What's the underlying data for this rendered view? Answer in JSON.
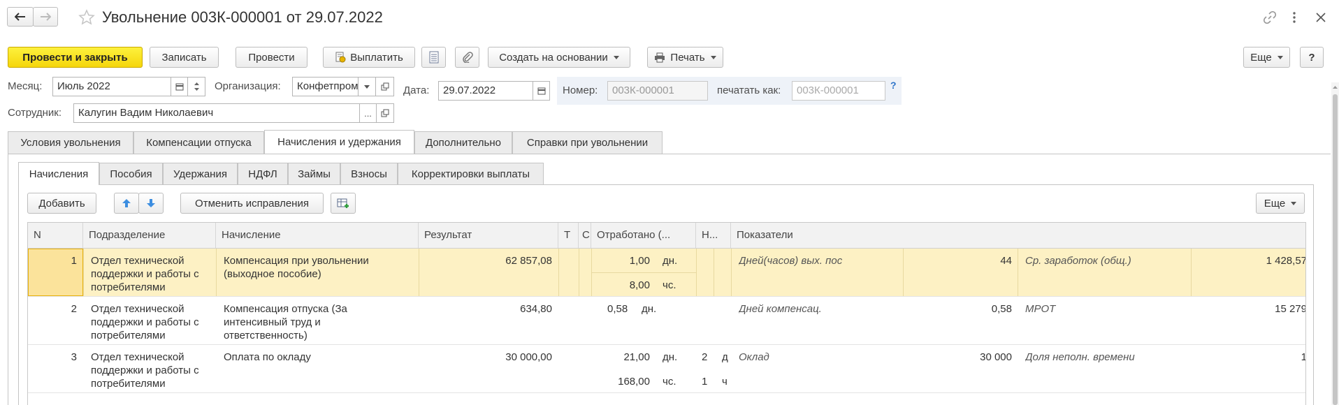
{
  "window": {
    "title": "Увольнение 003К-000001 от 29.07.2022"
  },
  "toolbar": {
    "post_close": "Провести и закрыть",
    "save": "Записать",
    "post": "Провести",
    "pay": "Выплатить",
    "create_based": "Создать на основании",
    "print": "Печать",
    "more": "Еще",
    "help": "?"
  },
  "form": {
    "month_label": "Месяц:",
    "month_value": "Июль 2022",
    "org_label": "Организация:",
    "org_value": "Конфетпром",
    "date_label": "Дата:",
    "date_value": "29.07.2022",
    "number_label": "Номер:",
    "number_value": "003К-000001",
    "print_as_label": "печатать как:",
    "print_as_placeholder": "003К-000001",
    "help_mark": "?",
    "employee_label": "Сотрудник:",
    "employee_value": "Калугин Вадим Николаевич",
    "ellipsis": "..."
  },
  "tabs": [
    "Условия увольнения",
    "Компенсации отпуска",
    "Начисления и удержания",
    "Дополнительно",
    "Справки при увольнении"
  ],
  "subtabs": [
    "Начисления",
    "Пособия",
    "Удержания",
    "НДФЛ",
    "Займы",
    "Взносы",
    "Корректировки выплаты"
  ],
  "grid_toolbar": {
    "add": "Добавить",
    "cancel_fix": "Отменить исправления",
    "more": "Еще"
  },
  "table": {
    "headers": {
      "n": "N",
      "dept": "Подразделение",
      "accrual": "Начисление",
      "result": "Результат",
      "t": "Т",
      "c": "С",
      "worked": "Отработано (...",
      "h": "Н...",
      "indicators": "Показатели"
    },
    "rows": [
      {
        "n": "1",
        "dept": [
          "Отдел технической",
          "поддержки и работы с",
          "потребителями"
        ],
        "accrual": [
          "Компенсация при увольнении",
          "(выходное пособие)"
        ],
        "result": "62 857,08",
        "worked1": "1,00",
        "unit1": "дн.",
        "worked2": "8,00",
        "unit2": "чс.",
        "h1": "",
        "h1u": "",
        "h2": "",
        "h2u": "",
        "ind1_name": "Дней(часов) вых. пос",
        "ind1_val": "44",
        "ind2_name": "Ср. заработок (общ.)",
        "ind2_val": "1 428,57"
      },
      {
        "n": "2",
        "dept": [
          "Отдел технической",
          "поддержки и работы с",
          "потребителями"
        ],
        "accrual": [
          "Компенсация отпуска (За",
          "интенсивный труд и",
          "ответственность)"
        ],
        "result": "634,80",
        "worked1": "0,58",
        "unit1": "дн.",
        "worked2": "",
        "unit2": "",
        "h1": "",
        "h1u": "",
        "h2": "",
        "h2u": "",
        "ind1_name": "Дней компенсац.",
        "ind1_val": "0,58",
        "ind2_name": "МРОТ",
        "ind2_val": "15 279"
      },
      {
        "n": "3",
        "dept": [
          "Отдел технической",
          "поддержки и работы с",
          "потребителями"
        ],
        "accrual": [
          "Оплата по окладу"
        ],
        "result": "30 000,00",
        "worked1": "21,00",
        "unit1": "дн.",
        "worked2": "168,00",
        "unit2": "чс.",
        "h1": "2",
        "h1u": "д",
        "h2": "1",
        "h2u": "ч",
        "ind1_name": "Оклад",
        "ind1_val": "30 000",
        "ind2_name": "Доля неполн. времени",
        "ind2_val": "1"
      }
    ]
  }
}
